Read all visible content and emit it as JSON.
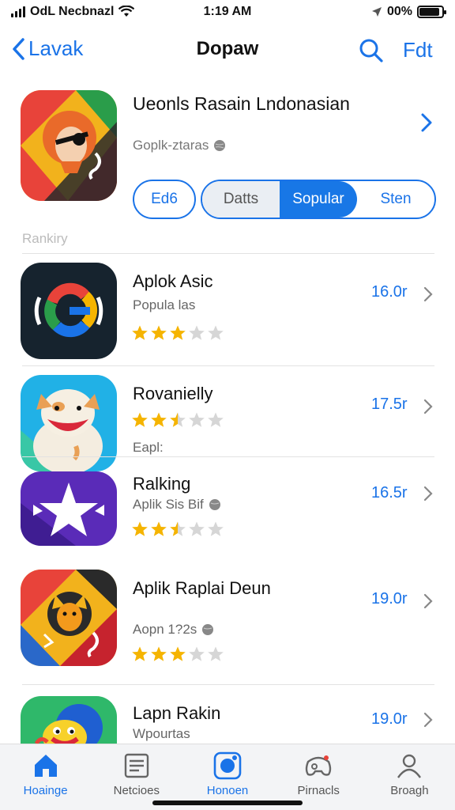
{
  "status_bar": {
    "carrier": "OdL Necbnazl",
    "time": "1:19 AM",
    "battery": "00%"
  },
  "nav": {
    "back_label": "Lavak",
    "title": "Dopaw",
    "edit_label": "Fdt"
  },
  "featured": {
    "title": "Ueonls Rasain Lndonasian",
    "subtitle": "Goplk-ztaras",
    "single_button": "Ed6",
    "segments": [
      "Datts",
      "Sopular",
      "Sten"
    ],
    "selected_segment": "Sopular"
  },
  "section_label": "Rankiry",
  "rankings": [
    {
      "title": "Aplok Asic",
      "subtitle": "Popula las",
      "rating": 3,
      "size": "16.0r",
      "icon": "google-logo-icon"
    },
    {
      "title": "Rovanielly",
      "subtitle": "Eapl:",
      "rating": 2.5,
      "size": "17.5r",
      "icon": "white-dog-icon"
    },
    {
      "title": "Ralking",
      "subtitle": "Aplik Sis Bif",
      "rating": 2.5,
      "size": "16.5r",
      "icon": "star-logo-icon"
    },
    {
      "title": "Aplik Raplai Deun",
      "subtitle": "Aopn 1?2s",
      "rating": 3,
      "size": "19.0r",
      "icon": "fox-icon"
    },
    {
      "title": "Lapn Rakin",
      "subtitle": "Wpourtas",
      "rating": null,
      "size": "19.0r",
      "icon": "cartoon-face-icon"
    }
  ],
  "tabs": [
    {
      "label": "Hoainge",
      "icon": "home-icon",
      "active": true
    },
    {
      "label": "Netcioes",
      "icon": "news-icon",
      "active": false
    },
    {
      "label": "Honoen",
      "icon": "apps-icon",
      "active": false
    },
    {
      "label": "Pirnacls",
      "icon": "controller-icon",
      "active": false
    },
    {
      "label": "Broagh",
      "icon": "person-icon",
      "active": false
    }
  ],
  "colors": {
    "accent": "#1a73e8",
    "star": "#f5b400",
    "star_empty": "#d6d6d6"
  }
}
